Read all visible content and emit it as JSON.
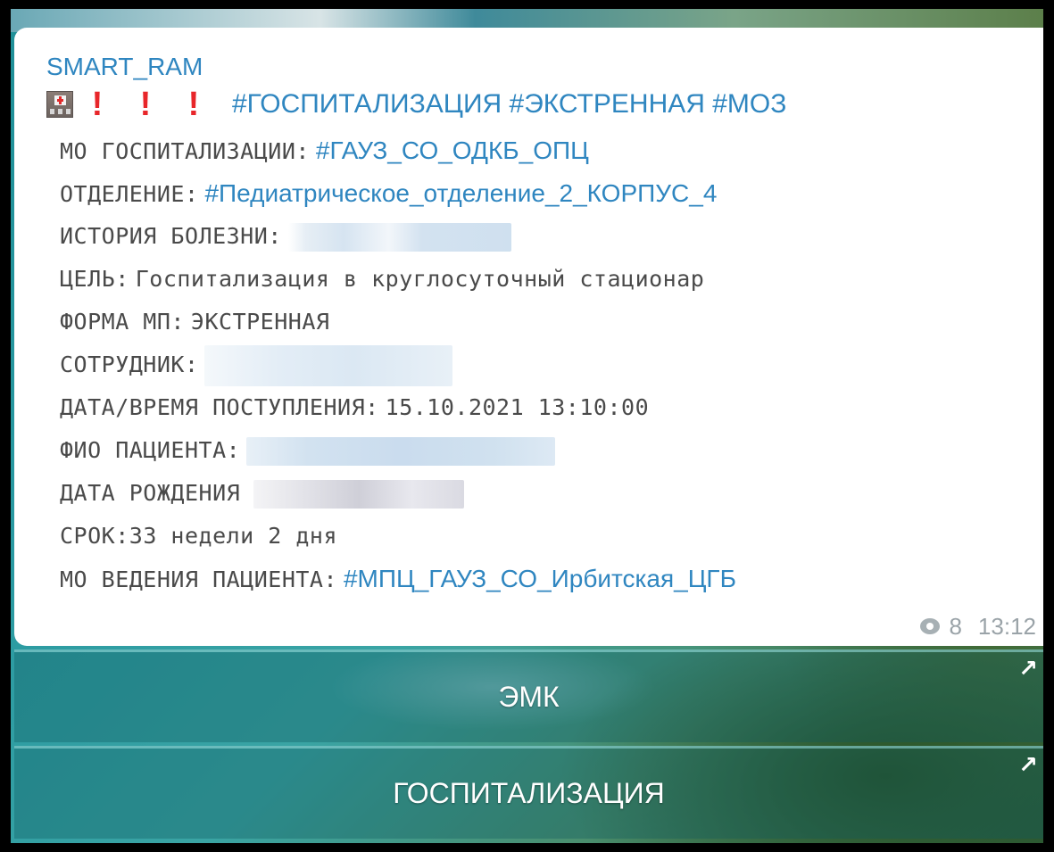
{
  "message": {
    "sender": "SMART_RAM",
    "hashtags": "#ГОСПИТАЛИЗАЦИЯ #ЭКСТРЕННАЯ #МОЗ",
    "exclaim": "!",
    "fields": {
      "mo_label": "МО ГОСПИТАЛИЗАЦИИ:",
      "mo_value": "#ГАУЗ_СО_ОДКБ_ОПЦ",
      "dept_label": "ОТДЕЛЕНИЕ:",
      "dept_value": "#Педиатрическое_отделение_2_КОРПУС_4",
      "history_label": "ИСТОРИЯ БОЛЕЗНИ:",
      "goal_label": "ЦЕЛЬ:",
      "goal_value": "Госпитализация в круглосуточный стационар",
      "form_label": "ФОРМА МП:",
      "form_value": "ЭКСТРЕННАЯ",
      "employee_label": "СОТРУДНИК:",
      "arrival_label": "ДАТА/ВРЕМЯ ПОСТУПЛЕНИЯ:",
      "arrival_value": "15.10.2021 13:10:00",
      "patient_label": "ФИО ПАЦИЕНТА:",
      "birth_label": "ДАТА РОЖДЕНИЯ",
      "term_label": "СРОК:",
      "term_value": "33 недели 2 дня",
      "mo_lead_label": "МО ВЕДЕНИЯ ПАЦИЕНТА:",
      "mo_lead_value": "#МПЦ_ГАУЗ_СО_Ирбитская_ЦГБ"
    },
    "views": "8",
    "time": "13:12"
  },
  "buttons": {
    "emk": "ЭМК",
    "hospitalization": "ГОСПИТАЛИЗАЦИЯ",
    "arrow": "↗"
  },
  "colors": {
    "link": "#2f86c0",
    "text": "#4a4a4a",
    "meta": "#9aa3a8",
    "exclaim": "#e8262a"
  },
  "icons": {
    "hospital": "hospital-icon",
    "views": "eye-icon",
    "button_link": "arrow-up-right-icon"
  }
}
